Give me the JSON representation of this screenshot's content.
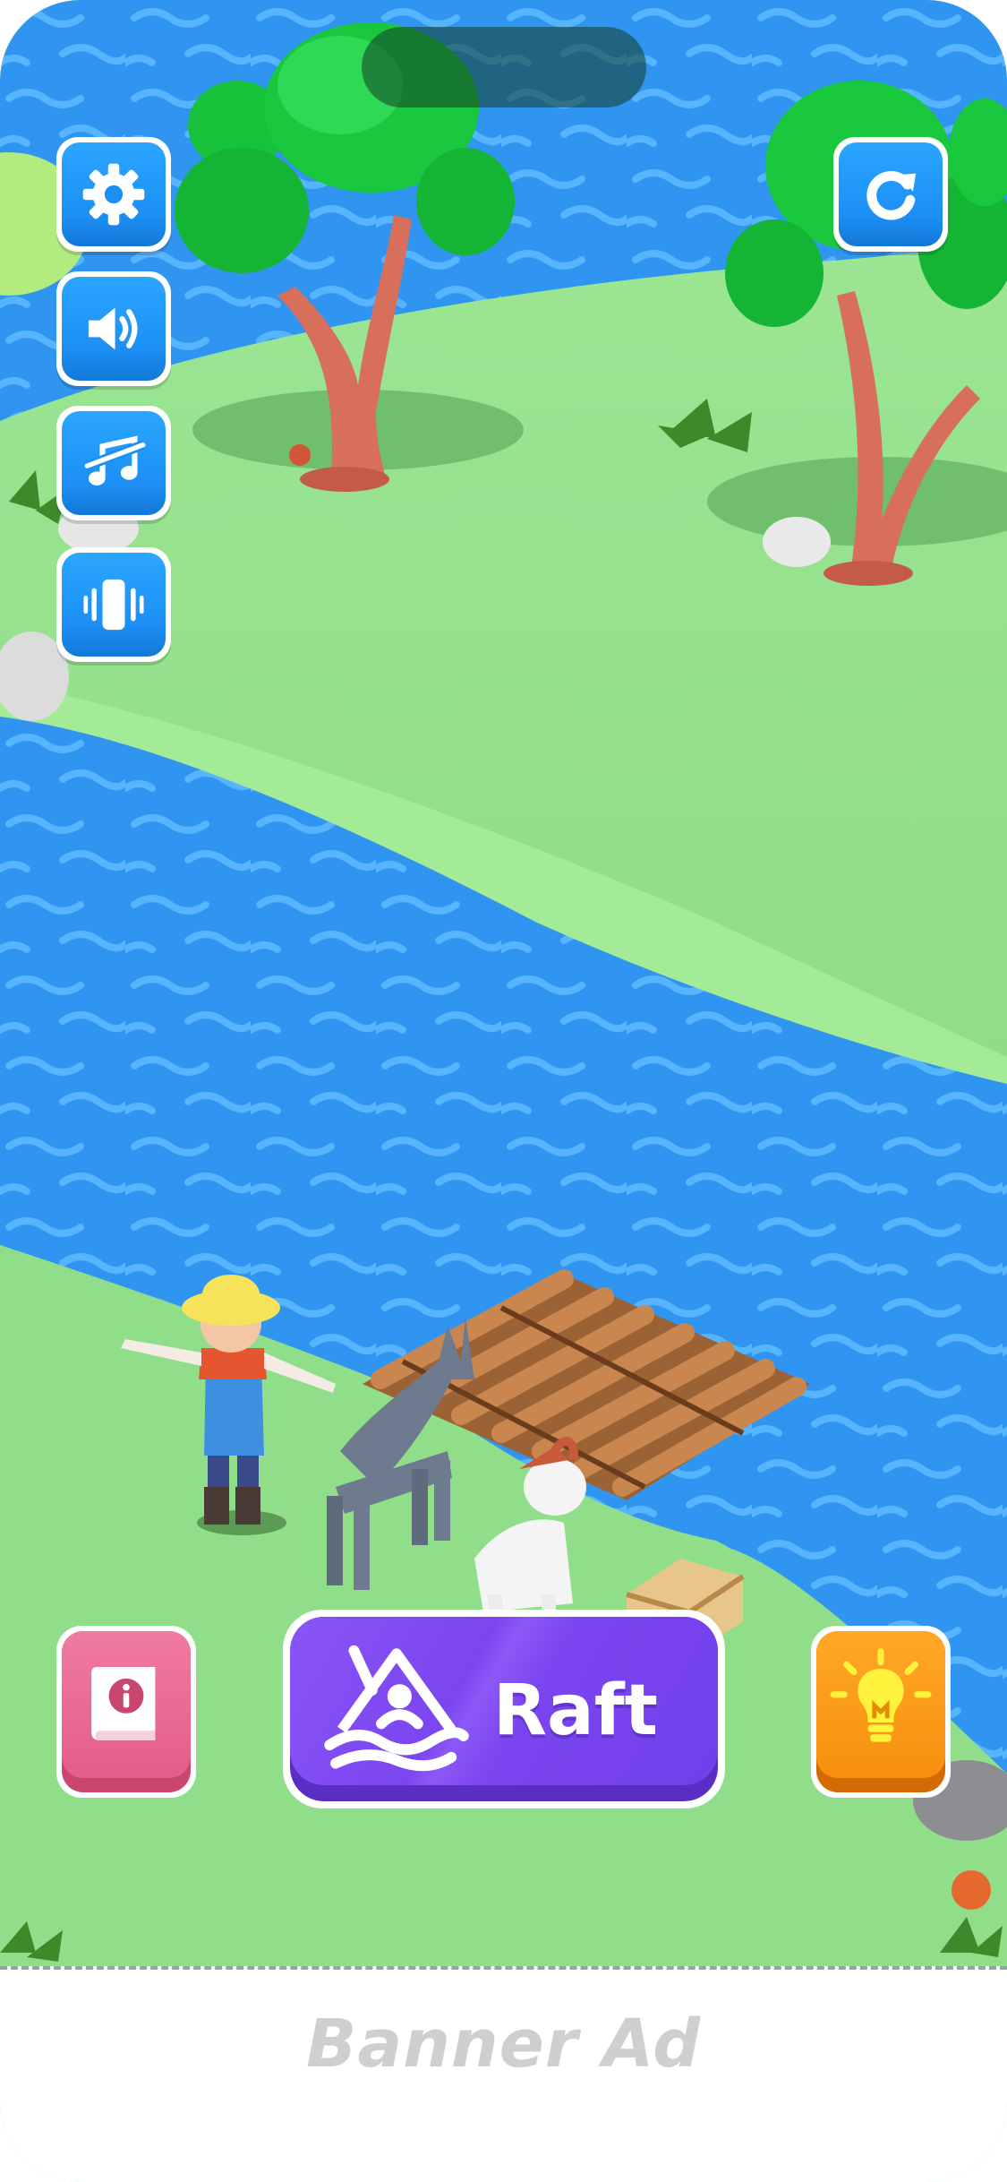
{
  "hud": {
    "settings_icon": "gear-icon",
    "sound_icon": "speaker-icon",
    "music_icon": "music-muted-icon",
    "vibration_icon": "vibration-icon",
    "restart_icon": "restart-icon"
  },
  "actions": {
    "info_icon": "info-book-icon",
    "raft_label": "Raft",
    "raft_icon": "kayak-icon",
    "hint_icon": "lightbulb-icon"
  },
  "banner": {
    "text": "Banner Ad"
  },
  "colors": {
    "grass": "#8fe08a",
    "water": "#2f95f0",
    "hud_blue": "#1c8ff5",
    "raft_purple": "#7b45f0",
    "info_pink": "#e8608c",
    "hint_orange": "#f7900f"
  }
}
